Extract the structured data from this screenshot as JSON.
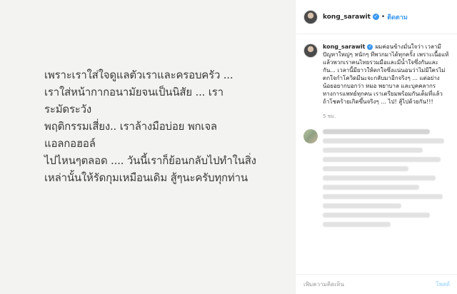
{
  "post": {
    "text": "เพราะเราใส่ใจดูแลตัวเราและครอบครัว ...\nเราใส่หน้ากากอนามัยจนเป็นนิสัย ... เราระมัดระวัง\nพฤติกรรมเสี่ยง.. เราล้างมือบ่อย พกเจลแอลกอฮอล์\nไปไหนๆตลอด .... วันนี้เราก็ย้อนกลับไปทำในสิ่ง\nเหล่านั้นให้รัดกุมเหมือนเดิม สู้ๆนะครับทุกท่าน"
  },
  "header": {
    "username": "kong_sarawit",
    "separator": "•",
    "follow_label": "ติดตาม",
    "verified_glyph": "✓"
  },
  "caption": {
    "username": "kong_sarawit",
    "verified_glyph": "✓",
    "text": "ผมค่อนข้างมั่นใจว่า เวลามีปัญหาใหญ่ๆ หนักๆ ทีพวกมาได้ทุกครั้ง เพราะเนื้อแท้แล้วพวกเราคนไทยรวมมือและมีน้ำใจซึ่งกันและกัน... เวลานี้มียาวให้ตกใจซึ่งแน่นอนว่าไม่มีใครไม่ตกใจกำโควิดมีนะจะกลับมาอีกจริงๆ ... แต่อย่างน้อยอยากบอกว่า หมอ พยาบาล และบุคคลากรทางการแพทย์ทุกคน เราเตรียมพร้อมกันเต็มที่แล้ว ถ้าโชคร้ายเกิดขึ้นจริงๆ ... ไป! สู้ไปด้วยกัน!!!",
    "time": "5 ชม."
  },
  "comment_box": {
    "placeholder": "เพิ่มความคิดเห็น",
    "post_label": "โพสต์"
  },
  "colors": {
    "accent": "#3897f0",
    "post_disabled": "#b2dffc",
    "image_bg": "#f3f3f1"
  }
}
